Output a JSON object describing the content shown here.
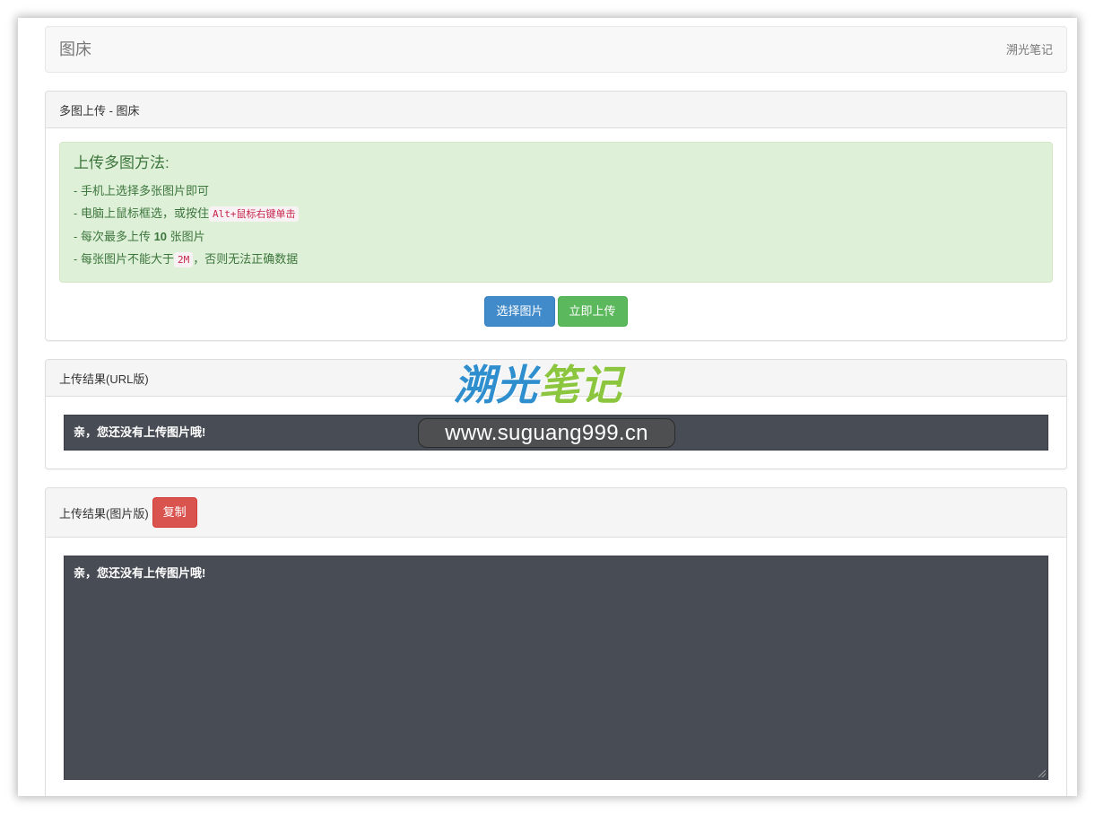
{
  "navbar": {
    "brand": "图床",
    "right_link": "溯光笔记"
  },
  "upload_panel": {
    "title": "多图上传 - 图床",
    "alert": {
      "heading": "上传多图方法:",
      "line1": "- 手机上选择多张图片即可",
      "line2_prefix": "- 电脑上鼠标框选，或按住",
      "line2_code": "Alt+鼠标右键单击",
      "line3_prefix": "- 每次最多上传 ",
      "line3_bold": "10",
      "line3_suffix": " 张图片",
      "line4_prefix": "- 每张图片不能大于",
      "line4_code": "2M",
      "line4_suffix": "，否则无法正确数据"
    },
    "select_button": "选择图片",
    "upload_button": "立即上传"
  },
  "url_panel": {
    "title": "上传结果(URL版)",
    "empty_message": "亲，您还没有上传图片哦!"
  },
  "image_panel": {
    "title": "上传结果(图片版)",
    "copy_button": "复制",
    "empty_message": "亲，您还没有上传图片哦!"
  },
  "watermark": {
    "logo_part1": "溯光",
    "logo_part2": "笔记",
    "url": "www.suguang999.cn"
  },
  "colors": {
    "primary": "#428bca",
    "success": "#5cb85c",
    "danger": "#d9534f",
    "alert_bg": "#dff0d8",
    "dark_box": "#484c55"
  }
}
